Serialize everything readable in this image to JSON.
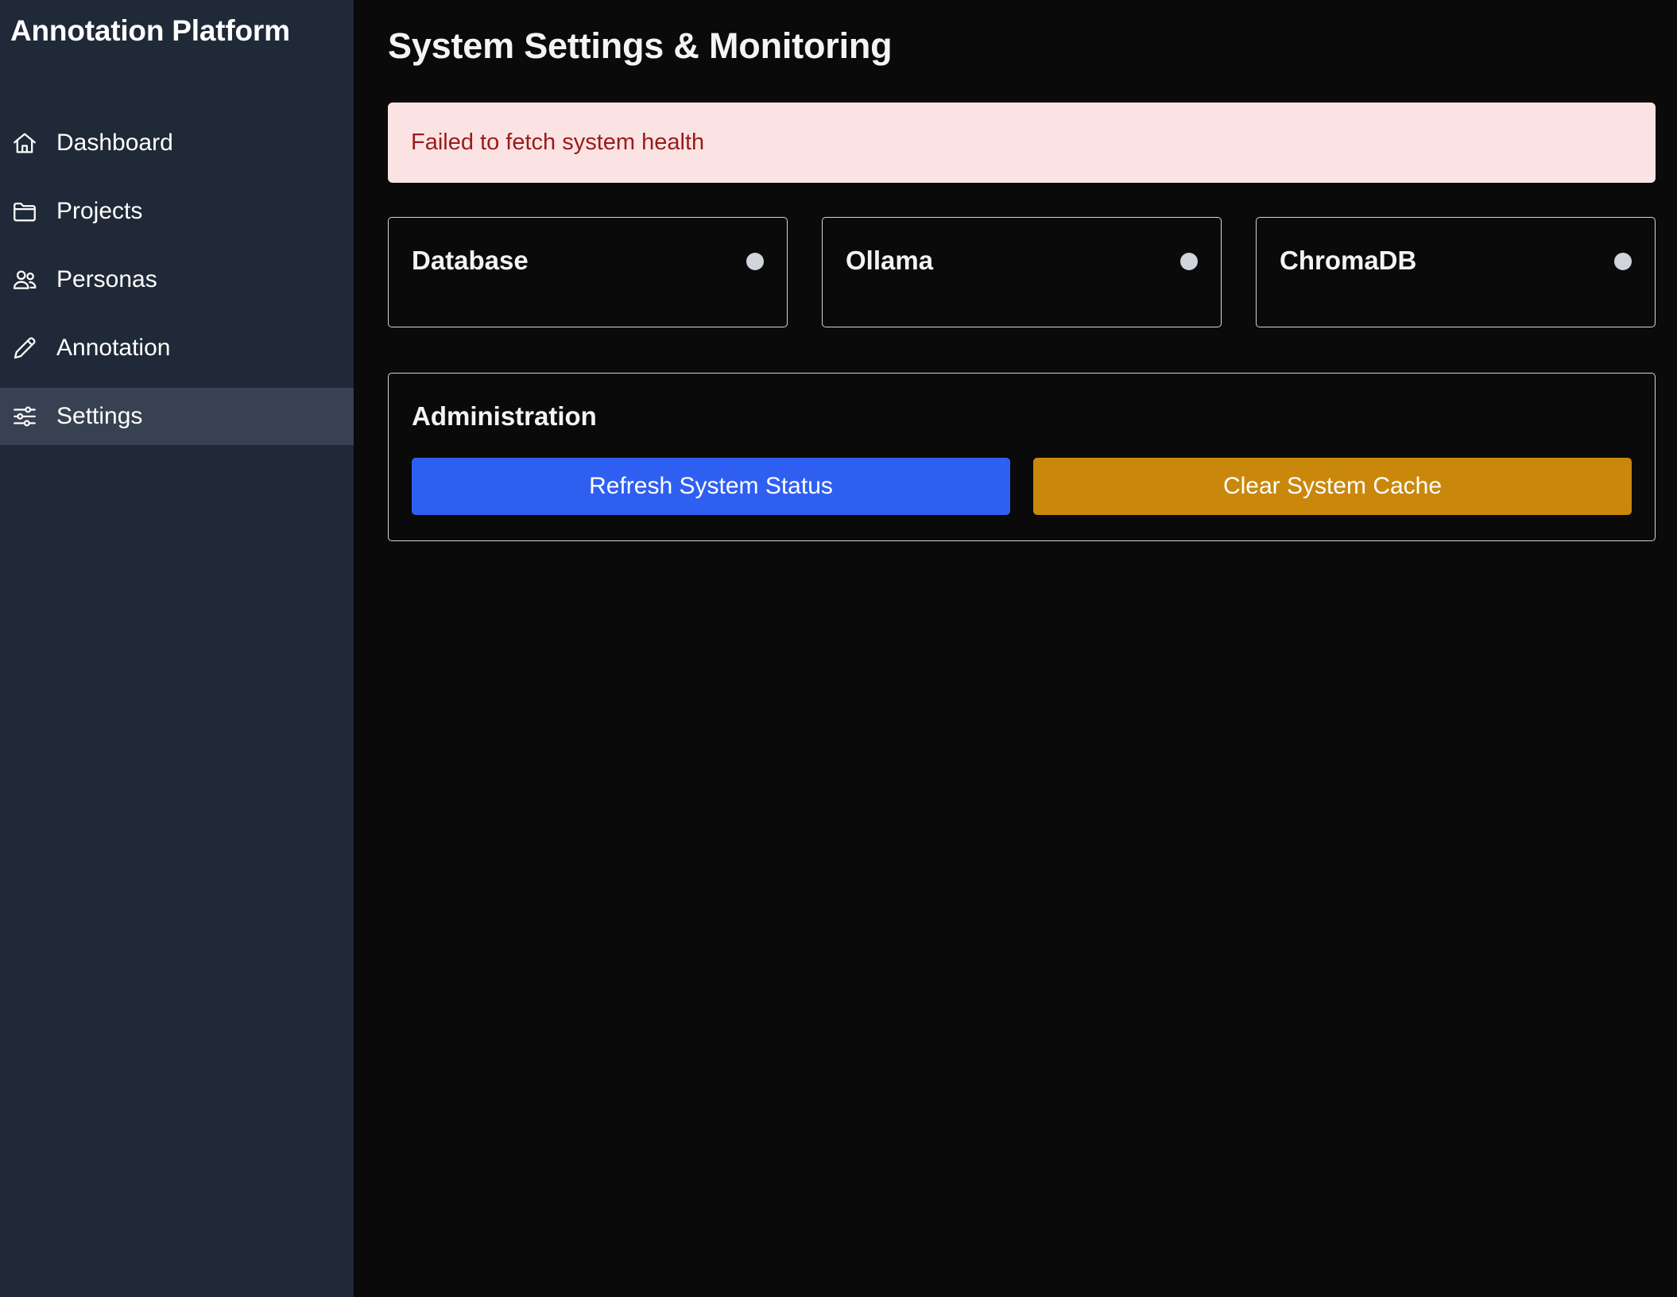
{
  "app": {
    "title": "Annotation Platform"
  },
  "sidebar": {
    "items": [
      {
        "label": "Dashboard",
        "icon": "home-icon",
        "active": false
      },
      {
        "label": "Projects",
        "icon": "folder-icon",
        "active": false
      },
      {
        "label": "Personas",
        "icon": "users-icon",
        "active": false
      },
      {
        "label": "Annotation",
        "icon": "pencil-icon",
        "active": false
      },
      {
        "label": "Settings",
        "icon": "sliders-icon",
        "active": true
      }
    ]
  },
  "main": {
    "title": "System Settings & Monitoring",
    "alert": {
      "message": "Failed to fetch system health",
      "background_color": "#fce3e3",
      "text_color": "#991b1b"
    },
    "health_cards": [
      {
        "name": "Database",
        "status_color": "#d1d5db"
      },
      {
        "name": "Ollama",
        "status_color": "#d1d5db"
      },
      {
        "name": "ChromaDB",
        "status_color": "#d1d5db"
      }
    ],
    "admin": {
      "title": "Administration",
      "refresh_label": "Refresh System Status",
      "clear_cache_label": "Clear System Cache",
      "refresh_color": "#2f5ff1",
      "clear_cache_color": "#c9880b"
    }
  },
  "colors": {
    "sidebar_bg": "#1f2937",
    "sidebar_active_bg": "#374151",
    "main_bg": "#0a0a0b"
  }
}
